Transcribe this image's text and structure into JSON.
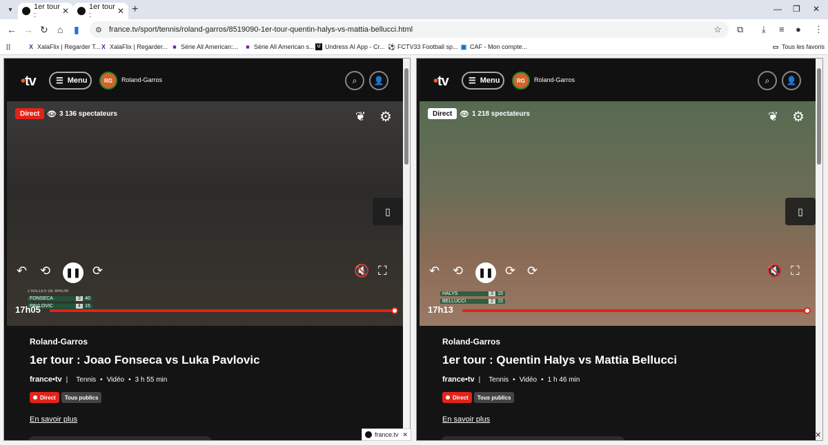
{
  "browser": {
    "tabs": [
      {
        "label": "1er tour :"
      },
      {
        "label": "1er tour :"
      }
    ],
    "url": "france.tv/sport/tennis/roland-garros/8519090-1er-tour-quentin-halys-vs-mattia-bellucci.html",
    "bookmarks": [
      {
        "label": "XalaFlix | Regarder T..."
      },
      {
        "label": "XalaFlix | Regarder..."
      },
      {
        "label": "Série All American:..."
      },
      {
        "label": "Série All American s..."
      },
      {
        "label": "Undress AI App - Cr..."
      },
      {
        "label": "FCTV33 Football sp..."
      },
      {
        "label": "CAF - Mon compte..."
      }
    ],
    "all_bookmarks": "Tous les favoris"
  },
  "site": {
    "logo": "tv",
    "menu_label": "Menu",
    "section": "Roland-Garros"
  },
  "left": {
    "direct": "Direct",
    "viewers": "3 136 spectateurs",
    "time": "17h05",
    "score": {
      "header": "2 BALLES DE BREAK",
      "p1": "FONSECA",
      "p1_set": "3",
      "p1_pts": "40",
      "p2": "PAVLOVIC",
      "p2_set": "4",
      "p2_pts": "15"
    },
    "category": "Roland-Garros",
    "title": "1er tour : Joao Fonseca vs Luka Pavlovic",
    "brand": "france•tv",
    "sport": "Tennis",
    "type": "Vidéo",
    "duration": "3 h 55 min",
    "pill_direct": "Direct",
    "pill_public": "Tous publics",
    "more": "En savoir plus"
  },
  "right": {
    "direct": "Direct",
    "viewers": "1 218 spectateurs",
    "time": "17h13",
    "score": {
      "p1": "HALYS",
      "p1_set": "3",
      "p1_pts": "15",
      "p2": "BELLUCCI",
      "p2_set": "2",
      "p2_pts": "15"
    },
    "category": "Roland-Garros",
    "title": "1er tour : Quentin Halys vs Mattia Bellucci",
    "brand": "france•tv",
    "sport": "Tennis",
    "type": "Vidéo",
    "duration": "1 h 46 min",
    "pill_direct": "Direct",
    "pill_public": "Tous publics",
    "more": "En savoir plus"
  },
  "popup": {
    "label": "france.tv"
  },
  "colors": {
    "accent": "#e2231a",
    "brand_dot": "#f15a24"
  }
}
